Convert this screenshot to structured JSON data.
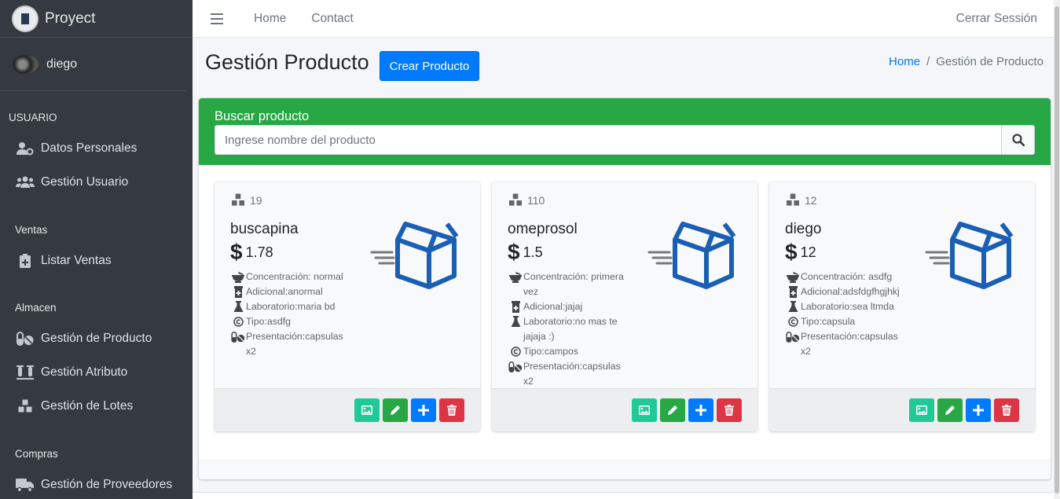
{
  "brand": {
    "title": "Proyect"
  },
  "user": {
    "name": "diego"
  },
  "sidebar": {
    "sections": [
      {
        "header": "USUARIO",
        "items": [
          {
            "label": "Datos Personales",
            "icon": "user-gear-icon"
          },
          {
            "label": "Gestión Usuario",
            "icon": "users-icon"
          }
        ]
      },
      {
        "header": "Ventas",
        "items": [
          {
            "label": "Listar Ventas",
            "icon": "notes-medical-icon"
          }
        ]
      },
      {
        "header": "Almacen",
        "items": [
          {
            "label": "Gestión de Producto",
            "icon": "pills-icon"
          },
          {
            "label": "Gestión Atributo",
            "icon": "vials-icon"
          },
          {
            "label": "Gestión de Lotes",
            "icon": "cubes-icon"
          }
        ]
      },
      {
        "header": "Compras",
        "items": [
          {
            "label": "Gestión de Proveedores",
            "icon": "truck-icon"
          }
        ]
      }
    ]
  },
  "topbar": {
    "home": "Home",
    "contact": "Contact",
    "logout": "Cerrar Sessión"
  },
  "page": {
    "title": "Gestión Producto",
    "create_button": "Crear Producto",
    "breadcrumb": {
      "home": "Home",
      "current": "Gestión de Producto"
    }
  },
  "search": {
    "label": "Buscar producto",
    "placeholder": "Ingrese nombre del producto"
  },
  "colors": {
    "primary": "#007bff",
    "success": "#28a745",
    "teal": "#20c997",
    "danger": "#dc3545",
    "sidebar": "#343a40",
    "box_icon": "#1a5fb4"
  },
  "products": [
    {
      "stock": "19",
      "name": "buscapina",
      "price": "1.78",
      "concentracion": "Concentración: normal",
      "adicional": "Adicional:anormal",
      "laboratorio": "Laboratorio:maria bd",
      "tipo": "Tipo:asdfg",
      "presentacion": "Presentación:capsulas x2"
    },
    {
      "stock": "110",
      "name": "omeprosol",
      "price": "1.5",
      "concentracion": "Concentración: primera vez",
      "adicional": "Adicional:jajaj",
      "laboratorio": "Laboratorio:no mas te jajaja :)",
      "tipo": "Tipo:campos",
      "presentacion": "Presentación:capsulas x2"
    },
    {
      "stock": "12",
      "name": "diego",
      "price": "12",
      "concentracion": "Concentración: asdfg",
      "adicional": "Adicional:adsfdgfhgjhkj",
      "laboratorio": "Laboratorio:sea ltmda",
      "tipo": "Tipo:capsula",
      "presentacion": "Presentación:capsulas x2"
    }
  ]
}
